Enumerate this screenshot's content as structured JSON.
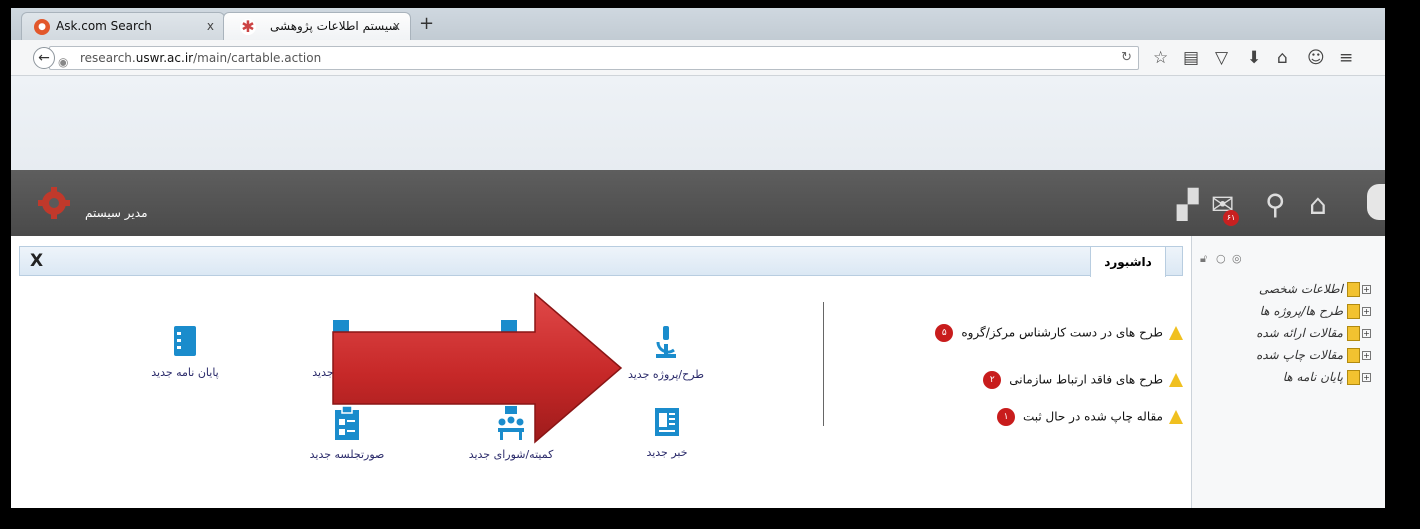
{
  "browser": {
    "tabs": [
      {
        "label": "Ask.com Search",
        "close": "x"
      },
      {
        "label": "سیستم اطلاعات پژوهشی",
        "close": "x"
      }
    ],
    "new_tab": "+",
    "url_prefix": "research.",
    "url_domain": "uswr.ac.ir",
    "url_path": "/main/cartable.action"
  },
  "app": {
    "user_label": "مدیر سیستم",
    "mail_count": "۶۱"
  },
  "panel": {
    "close_label": "X",
    "tab_title": "داشبورد"
  },
  "sidebar": {
    "items": [
      "اطلاعات شخصی",
      "طرح ها/پروژه ها",
      "مقالات ارائه شده",
      "مقالات چاپ شده",
      "پایان نامه ها"
    ]
  },
  "alerts": [
    {
      "text": "طرح های در دست کارشناس مرکز/گروه",
      "count": "۵"
    },
    {
      "text": "طرح های فاقد ارتباط سازمانی",
      "count": "۲"
    },
    {
      "text": "مقاله چاپ شده در حال ثبت",
      "count": "۱"
    }
  ],
  "shortcuts": {
    "new_project": "طرح/پروژه جدید",
    "new_news": "خبر جدید",
    "new_committee": "کمیته/شورای جدید",
    "new_minutes": "صورتجلسه جدید",
    "new_thesis": "پایان نامه جدید",
    "new_partial": "جدید"
  },
  "colors": {
    "arrow": "#c62828",
    "shortcut_icon": "#1a8ccc",
    "badge": "#c81c1c"
  }
}
